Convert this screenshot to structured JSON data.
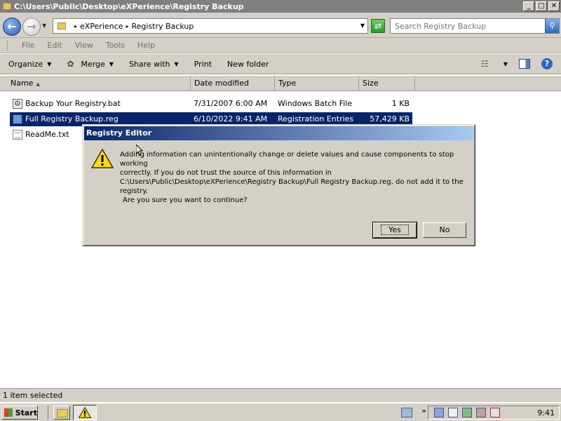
{
  "window": {
    "title": "C:\\Users\\Public\\Desktop\\eXPerience\\Registry Backup",
    "buttons": [
      "_",
      "□",
      "✕"
    ]
  },
  "address": {
    "crumbs": [
      "eXPerience",
      "Registry Backup"
    ],
    "search_placeholder": "Search Registry Backup"
  },
  "menu": [
    "File",
    "Edit",
    "View",
    "Tools",
    "Help"
  ],
  "commands": {
    "organize": "Organize",
    "merge": "Merge",
    "share": "Share with",
    "print": "Print",
    "new_folder": "New folder"
  },
  "columns": {
    "name": "Name",
    "date": "Date modified",
    "type": "Type",
    "size": "Size"
  },
  "files": [
    {
      "name": "Backup Your Registry.bat",
      "date": "7/31/2007 6:00 AM",
      "type": "Windows Batch File",
      "size": "1 KB",
      "icon": "batch-file-icon"
    },
    {
      "name": "Full Registry Backup.reg",
      "date": "6/10/2022 9:41 AM",
      "type": "Registration Entries",
      "size": "57,429 KB",
      "icon": "registry-file-icon"
    },
    {
      "name": "ReadMe.txt",
      "date": "",
      "type": "",
      "size": "",
      "icon": "text-file-icon"
    }
  ],
  "dialog": {
    "title": "Registry Editor",
    "message": "Adding information can unintentionally change or delete values and cause components to stop working\ncorrectly. If you do not trust the source of this information in\nC:\\Users\\Public\\Desktop\\eXPerience\\Registry Backup\\Full Registry Backup.reg, do not add it to the\nregistry.",
    "question": "Are you sure you want to continue?",
    "yes": "Yes",
    "no": "No"
  },
  "status": "1 item selected",
  "taskbar": {
    "start": "Start",
    "time": "9:41"
  },
  "colors": {
    "selection": "#0a246a",
    "titlebar_inactive": "#808080",
    "chrome": "#d4d0c8"
  }
}
